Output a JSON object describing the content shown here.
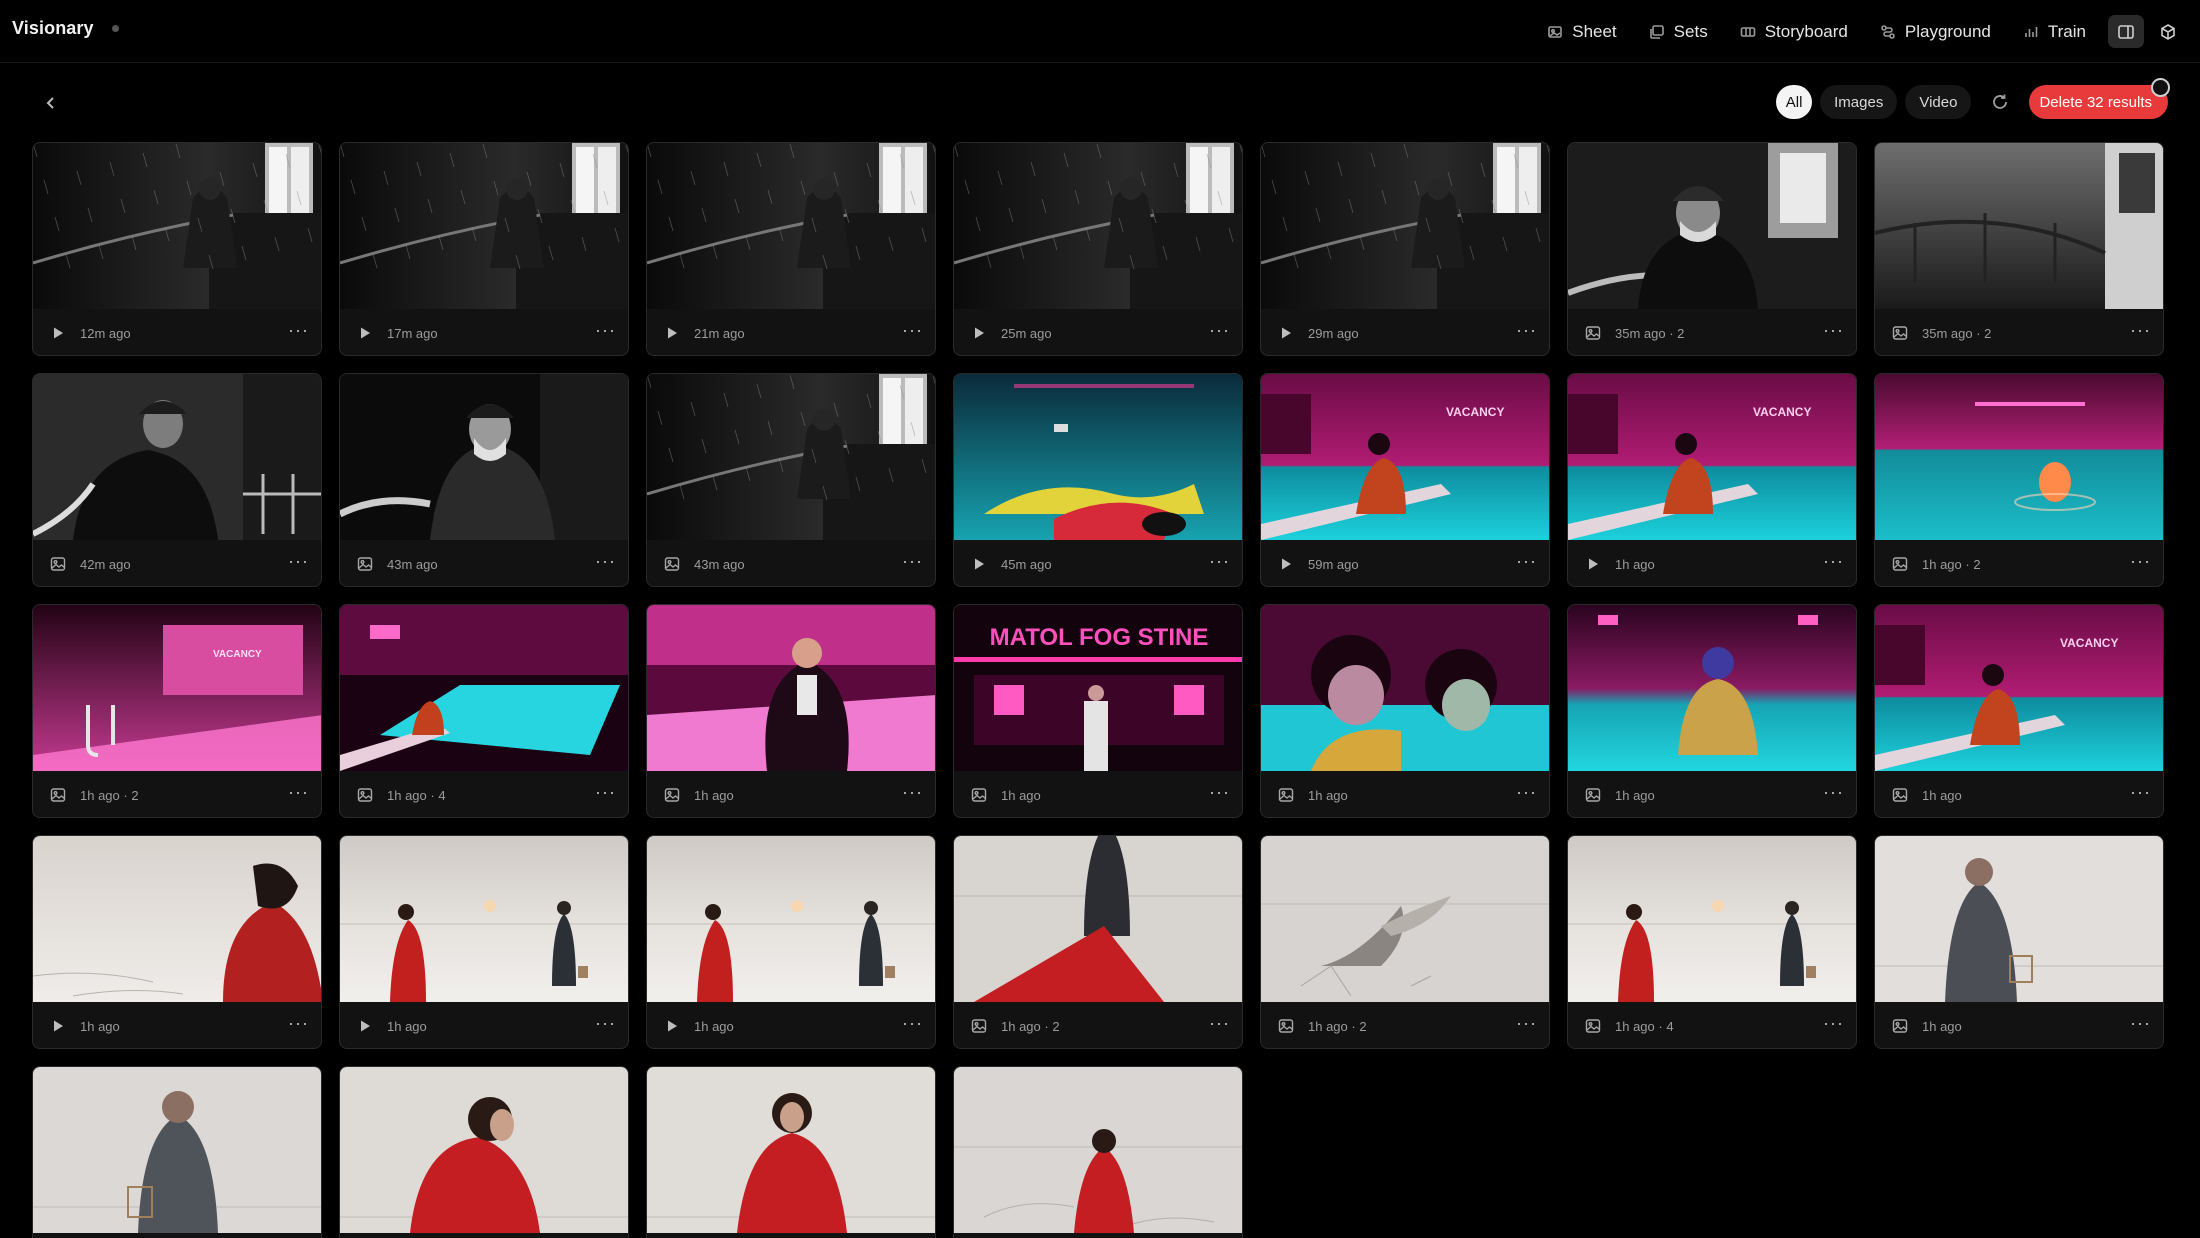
{
  "app": {
    "name": "Visionary"
  },
  "nav": {
    "items": [
      {
        "label": "Sheet",
        "icon": "sheet-icon"
      },
      {
        "label": "Sets",
        "icon": "sets-icon"
      },
      {
        "label": "Storyboard",
        "icon": "storyboard-icon"
      },
      {
        "label": "Playground",
        "icon": "playground-icon"
      },
      {
        "label": "Train",
        "icon": "train-icon"
      }
    ]
  },
  "toolbar": {
    "filters": [
      "All",
      "Images",
      "Video"
    ],
    "active_filter": "All",
    "delete_label": "Delete 32 results"
  },
  "grid": {
    "items": [
      {
        "type": "video",
        "time": "12m ago",
        "scene": "rain-bw"
      },
      {
        "type": "video",
        "time": "17m ago",
        "scene": "rain-bw"
      },
      {
        "type": "video",
        "time": "21m ago",
        "scene": "rain-bw"
      },
      {
        "type": "video",
        "time": "25m ago",
        "scene": "rain-bw"
      },
      {
        "type": "video",
        "time": "29m ago",
        "scene": "rain-bw"
      },
      {
        "type": "image",
        "time": "35m ago · 2",
        "scene": "captain-bw"
      },
      {
        "type": "image",
        "time": "35m ago · 2",
        "scene": "deck-bw"
      },
      {
        "type": "image",
        "time": "42m ago",
        "scene": "captain-side-bw"
      },
      {
        "type": "image",
        "time": "43m ago",
        "scene": "captain-front-bw"
      },
      {
        "type": "image",
        "time": "43m ago",
        "scene": "rain-bw"
      },
      {
        "type": "video",
        "time": "45m ago",
        "scene": "pool-floating"
      },
      {
        "type": "video",
        "time": "59m ago",
        "scene": "pool-vacancy"
      },
      {
        "type": "video",
        "time": "1h ago",
        "scene": "pool-vacancy"
      },
      {
        "type": "image",
        "time": "1h ago · 2",
        "scene": "pool-lantern"
      },
      {
        "type": "image",
        "time": "1h ago · 2",
        "scene": "pool-ladder"
      },
      {
        "type": "image",
        "time": "1h ago · 4",
        "scene": "pool-wide"
      },
      {
        "type": "image",
        "time": "1h ago",
        "scene": "pool-man"
      },
      {
        "type": "image",
        "time": "1h ago",
        "scene": "motel-sign",
        "sign": "MATOL FOG STINE"
      },
      {
        "type": "image",
        "time": "1h ago",
        "scene": "pool-faces"
      },
      {
        "type": "image",
        "time": "1h ago",
        "scene": "pool-girl"
      },
      {
        "type": "image",
        "time": "1h ago",
        "scene": "pool-vacancy"
      },
      {
        "type": "video",
        "time": "1h ago",
        "scene": "salt-woman-close"
      },
      {
        "type": "video",
        "time": "1h ago",
        "scene": "salt-pair"
      },
      {
        "type": "video",
        "time": "1h ago",
        "scene": "salt-pair"
      },
      {
        "type": "image",
        "time": "1h ago · 2",
        "scene": "salt-cape"
      },
      {
        "type": "image",
        "time": "1h ago · 2",
        "scene": "salt-bird"
      },
      {
        "type": "image",
        "time": "1h ago · 4",
        "scene": "salt-pair"
      },
      {
        "type": "image",
        "time": "1h ago",
        "scene": "salt-man-cage"
      },
      {
        "type": "image",
        "time": "",
        "scene": "salt-man-front",
        "partial": true
      },
      {
        "type": "image",
        "time": "",
        "scene": "salt-woman-profile",
        "partial": true
      },
      {
        "type": "image",
        "time": "",
        "scene": "salt-woman-front",
        "partial": true
      },
      {
        "type": "image",
        "time": "",
        "scene": "salt-woman-back",
        "partial": true
      }
    ]
  }
}
